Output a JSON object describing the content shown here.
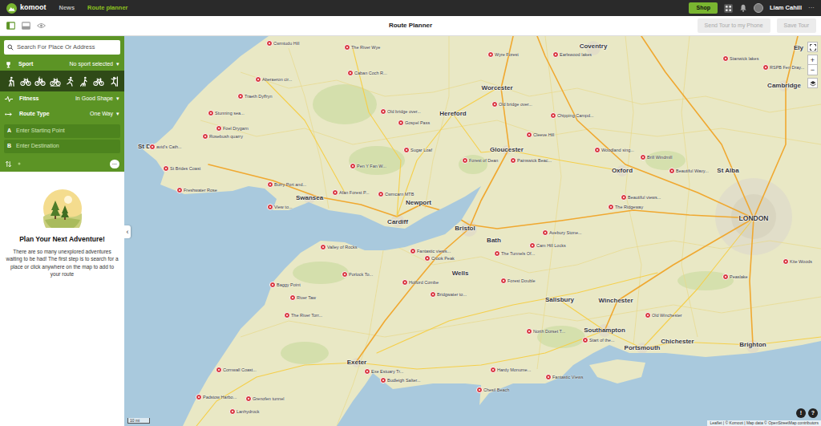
{
  "topbar": {
    "logo": "komoot",
    "nav": [
      {
        "label": "News",
        "selected": false
      },
      {
        "label": "Route planner",
        "selected": true
      }
    ],
    "shop": "Shop",
    "user": "Liam Cahill",
    "more": "···"
  },
  "toolbar": {
    "title": "Route Planner",
    "views": [
      {
        "kind": "sidebar",
        "selected": true
      },
      {
        "kind": "bottom",
        "selected": false
      },
      {
        "kind": "eye",
        "selected": false
      }
    ],
    "buttons": [
      {
        "label": "Send Tour to my Phone",
        "disabled": true
      },
      {
        "label": "Save Tour",
        "disabled": true
      }
    ]
  },
  "planner": {
    "search": {
      "placeholder": "Search For Place Or Address"
    },
    "sport": {
      "label": "Sport",
      "value": "No sport selected",
      "caret": "▾"
    },
    "sports": [
      {
        "kind": "hike",
        "selected": false
      },
      {
        "kind": "touring",
        "selected": false
      },
      {
        "kind": "ebike",
        "selected": false
      },
      {
        "kind": "mtb",
        "selected": false
      },
      {
        "kind": "run",
        "selected": false
      },
      {
        "kind": "mountaineering",
        "selected": false
      },
      {
        "kind": "road",
        "selected": false
      },
      {
        "kind": "climbing",
        "selected": false
      }
    ],
    "fitness": {
      "label": "Fitness",
      "value": "In Good Shape",
      "caret": "▾"
    },
    "route_type": {
      "label": "Route Type",
      "value": "One Way",
      "caret": "▾"
    },
    "waypoints": [
      {
        "letter": "A",
        "placeholder": "Enter Starting Point"
      },
      {
        "letter": "B",
        "placeholder": "Enter Destination"
      }
    ],
    "more": "···"
  },
  "empty_state": {
    "title": "Plan Your Next Adventure!",
    "text": "There are so many unexplored adventures waiting to be had! The first step is to search for a place or click anywhere on the map to add to your route"
  },
  "map": {
    "cities": [
      {
        "name": "Coventry"
      },
      {
        "name": "Worcester"
      },
      {
        "name": "Hereford"
      },
      {
        "name": "Gloucester"
      },
      {
        "name": "Oxford"
      },
      {
        "name": "St Alba"
      },
      {
        "name": "LONDON"
      },
      {
        "name": "Swansea"
      },
      {
        "name": "Newport"
      },
      {
        "name": "Cardiff"
      },
      {
        "name": "Bristol"
      },
      {
        "name": "Bath"
      },
      {
        "name": "Wells"
      },
      {
        "name": "Salisbury"
      },
      {
        "name": "Winchester"
      },
      {
        "name": "Southampton"
      },
      {
        "name": "Portsmouth"
      },
      {
        "name": "Chichester"
      },
      {
        "name": "Brighton"
      },
      {
        "name": "Exeter"
      },
      {
        "name": "Ely"
      },
      {
        "name": "Cambridge"
      },
      {
        "name": "St D"
      }
    ],
    "pois": [
      {
        "label": "Cwmtudu Hill"
      },
      {
        "label": "The River Wye"
      },
      {
        "label": "Aberaeron cir..."
      },
      {
        "label": "Caban Coch R..."
      },
      {
        "label": "Traeth Dyffryn"
      },
      {
        "label": "Stunning sea..."
      },
      {
        "label": "Foel Drygarn"
      },
      {
        "label": "Rosebush quarry"
      },
      {
        "label": "avid's Cath..."
      },
      {
        "label": "St Brides Coast"
      },
      {
        "label": "Freshwater Rose"
      },
      {
        "label": "Burry Port and..."
      },
      {
        "label": "View to..."
      },
      {
        "label": "Afan Forest P..."
      },
      {
        "label": "Pen Y Fan W..."
      },
      {
        "label": "Cwmcarn MTB"
      },
      {
        "label": "Old bridge over..."
      },
      {
        "label": "Gospel Pass"
      },
      {
        "label": "Sugar Loaf"
      },
      {
        "label": "Forest of Dean"
      },
      {
        "label": "Painswick Beac..."
      },
      {
        "label": "Cleeve Hill"
      },
      {
        "label": "Chipping Campd..."
      },
      {
        "label": "Old bridge over..."
      },
      {
        "label": "Wyre Forest"
      },
      {
        "label": "Earlswood lakes"
      },
      {
        "label": "Woodland sing..."
      },
      {
        "label": "Brill Windmill"
      },
      {
        "label": "Beautiful Wavy..."
      },
      {
        "label": "Beautiful views..."
      },
      {
        "label": "The Ridgeway"
      },
      {
        "label": "Avebury Stone..."
      },
      {
        "label": "Cam Hill Locks"
      },
      {
        "label": "The Tunnels Of..."
      },
      {
        "label": "Fantastic views..."
      },
      {
        "label": "Crook Peak"
      },
      {
        "label": "Valley of Rocks"
      },
      {
        "label": "Porlock To..."
      },
      {
        "label": "Baggy Point"
      },
      {
        "label": "River Taw"
      },
      {
        "label": "The River Torr..."
      },
      {
        "label": "Holford Combe"
      },
      {
        "label": "Bridgwater to..."
      },
      {
        "label": "Forest Double"
      },
      {
        "label": "North Dorset T..."
      },
      {
        "label": "Cornwall Coast..."
      },
      {
        "label": "Padstow Harbo..."
      },
      {
        "label": "Grenofen tunnel"
      },
      {
        "label": "Lanhydrock"
      },
      {
        "label": "Exe Estuary Tr..."
      },
      {
        "label": "Budleigh Salter..."
      },
      {
        "label": "Hardy Monume..."
      },
      {
        "label": "Chesil Beach"
      },
      {
        "label": "Fantastic Views"
      },
      {
        "label": "Old Winchester"
      },
      {
        "label": "Start of the..."
      },
      {
        "label": "Peaslake"
      },
      {
        "label": "Kite Woods"
      },
      {
        "label": "RSPB Fen Dray..."
      },
      {
        "label": "Stanwick lakes"
      }
    ],
    "zoom_in": "+",
    "zoom_out": "−",
    "help": [
      "!",
      "?"
    ],
    "collapse": "‹",
    "scale": "10 mi",
    "attribution": "Leaflet | © Komoot | Map data © OpenStreetMap contributors"
  }
}
